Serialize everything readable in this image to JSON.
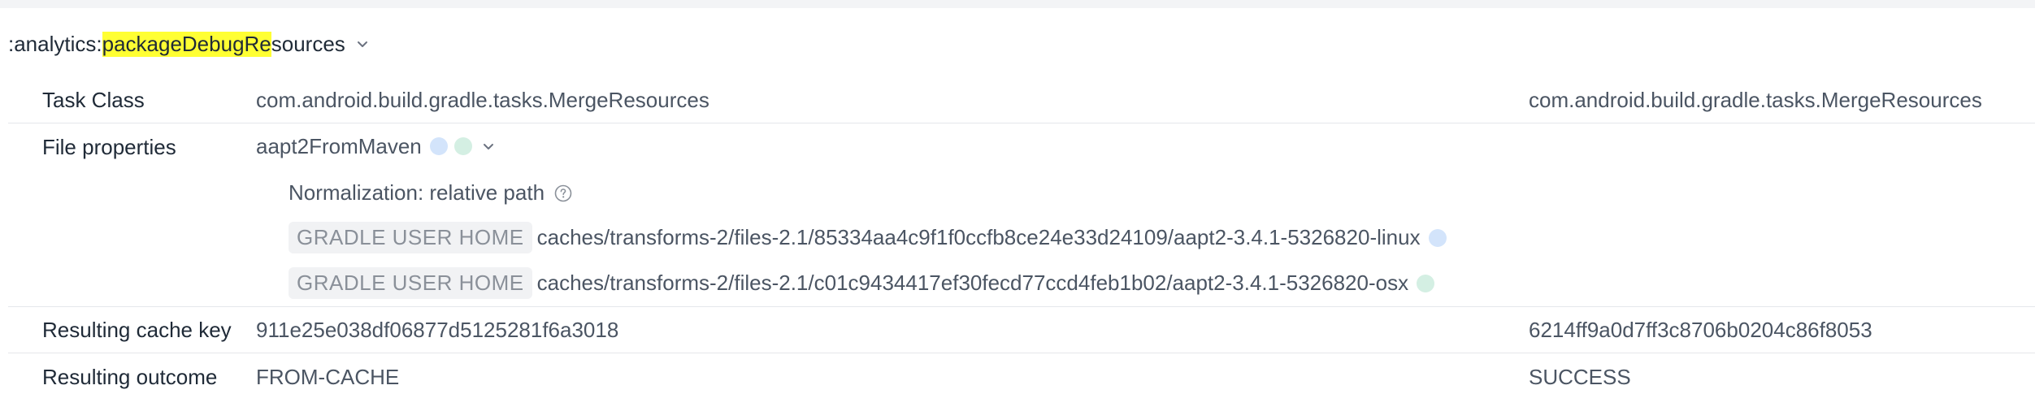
{
  "task": {
    "prefix": ":analytics:",
    "highlight": "packageDebugRe",
    "suffix": "sources"
  },
  "rows": {
    "task_class": {
      "label": "Task Class",
      "left": "com.android.build.gradle.tasks.MergeResources",
      "right": "com.android.build.gradle.tasks.MergeResources"
    },
    "file_properties": {
      "label": "File properties",
      "property_name": "aapt2FromMaven",
      "normalization": "Normalization: relative path",
      "files": [
        {
          "badge": "GRADLE USER HOME",
          "path": "caches/transforms-2/files-2.1/85334aa4c9f1f0ccfb8ce24e33d24109/aapt2-3.4.1-5326820-linux",
          "marker_color": "#d3e4fb"
        },
        {
          "badge": "GRADLE USER HOME",
          "path": "caches/transforms-2/files-2.1/c01c9434417ef30fecd77ccd4feb1b02/aapt2-3.4.1-5326820-osx",
          "marker_color": "#d4efe3"
        }
      ]
    },
    "cache_key": {
      "label": "Resulting cache key",
      "left": "911e25e038df06877d5125281f6a3018",
      "right": "6214ff9a0d7ff3c8706b0204c86f8053"
    },
    "outcome": {
      "label": "Resulting outcome",
      "left": "FROM-CACHE",
      "right": "SUCCESS"
    }
  },
  "colors": {
    "highlight": "#ffff33",
    "marker_blue": "#d3e4fb",
    "marker_green": "#d4efe3"
  }
}
